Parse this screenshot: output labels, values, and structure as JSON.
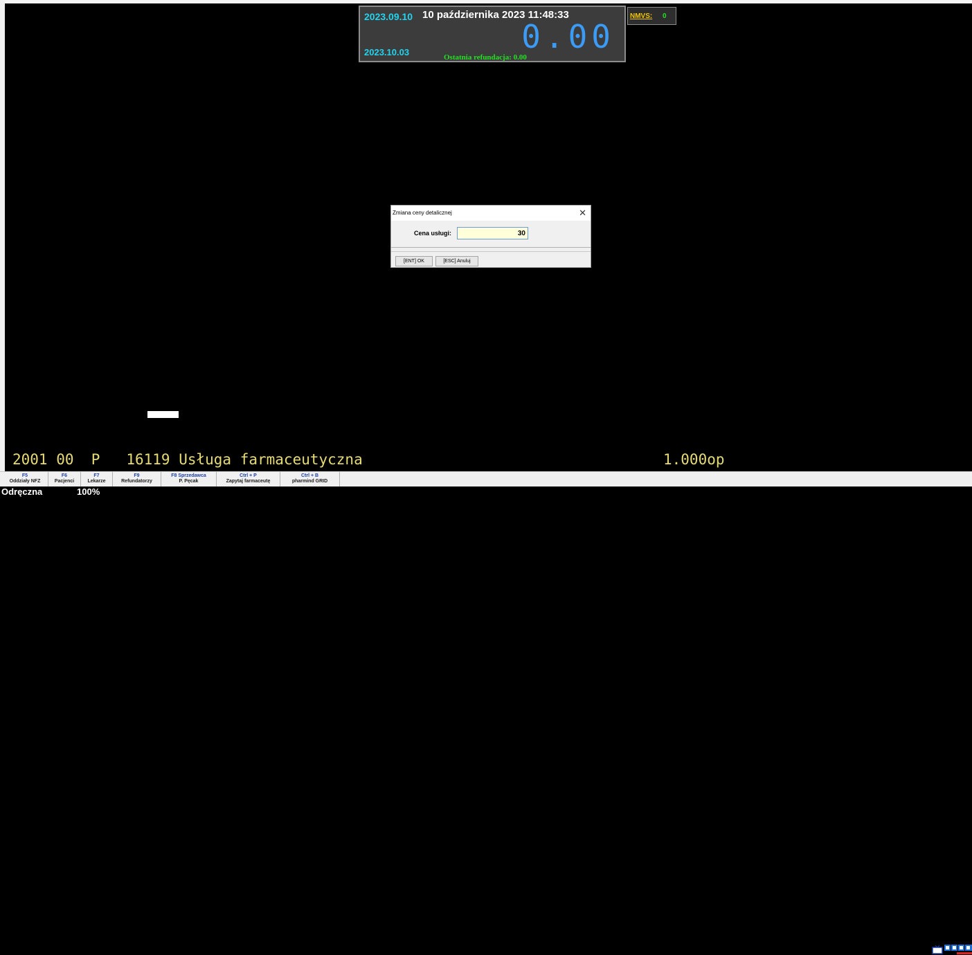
{
  "info_panel": {
    "date_start": "2023.09.10",
    "date_long": "10 października 2023  11:48:33",
    "amount": "0.00",
    "date_end": "2023.10.03",
    "last_refund": "Ostatnia refundacja: 0.00"
  },
  "nmvs": {
    "label": "NMVS:",
    "value": "0"
  },
  "dialog": {
    "title": "Zmiana ceny detalicznej",
    "close_icon": "close-icon",
    "field_label": "Cena usługi:",
    "field_value": "30",
    "ok_label": "[ENT] OK",
    "cancel_label": "[ESC] Anuluj"
  },
  "item": {
    "line": "2001 00  P   16119 Usługa farmaceutyczna",
    "quantity": "1.000op"
  },
  "fkeys": [
    {
      "key": "F5",
      "desc": "Oddziały NFZ"
    },
    {
      "key": "F6",
      "desc": "Pacjenci"
    },
    {
      "key": "F7",
      "desc": "Lekarze"
    },
    {
      "key": "F9",
      "desc": "Refundatorzy"
    },
    {
      "key": "F8 Sprzedawca",
      "desc": "P. Pęcak"
    },
    {
      "key": "Ctrl + P",
      "desc": "Zapytaj farmaceutę"
    },
    {
      "key": "Ctrl + B",
      "desc": "pharmind GRID"
    }
  ],
  "status": {
    "mode": "Odręczna",
    "zoom": "100%"
  },
  "colors": {
    "background": "#000000",
    "panel": "#3c3c3c",
    "cyan": "#22d3ee",
    "amount_blue": "#3b9bf5",
    "green": "#22e022",
    "item_yellow": "#e6db74"
  }
}
